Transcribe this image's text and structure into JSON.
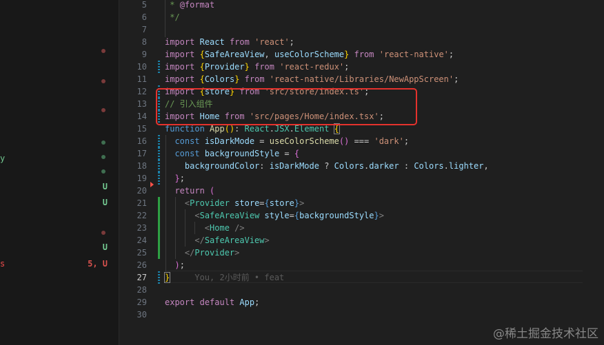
{
  "sidebar": {
    "fragments": [
      {
        "text": "y",
        "color": "#73c991"
      },
      {
        "text": "s",
        "color": "#f14c4c"
      }
    ],
    "status_letters": [
      "U",
      "U",
      "U",
      "U",
      "5, U"
    ]
  },
  "gutter": {
    "line_numbers": [
      "5",
      "6",
      "7",
      "8",
      "9",
      "10",
      "11",
      "12",
      "13",
      "14",
      "15",
      "16",
      "17",
      "18",
      "19",
      "20",
      "21",
      "22",
      "23",
      "24",
      "25",
      "26",
      "27",
      "28",
      "29",
      "30"
    ],
    "active_line": "27"
  },
  "code": {
    "l5": {
      "t1": " * ",
      "t2": "@format"
    },
    "l6": {
      "t1": " */"
    },
    "l8": {
      "k": "import",
      "a": "React",
      "f": "from",
      "s": "'react'",
      "e": ";"
    },
    "l9": {
      "k": "import",
      "o": "{",
      "a": "SafeAreaView",
      "c": ", ",
      "b": "useColorScheme",
      "x": "}",
      "f": "from",
      "s": "'react-native'",
      "e": ";"
    },
    "l10": {
      "k": "import",
      "o": "{",
      "a": "Provider",
      "x": "}",
      "f": "from",
      "s": "'react-redux'",
      "e": ";"
    },
    "l11": {
      "k": "import",
      "o": "{",
      "a": "Colors",
      "x": "}",
      "f": "from",
      "s": "'react-native/Libraries/NewAppScreen'",
      "e": ";"
    },
    "l12": {
      "k": "import",
      "o": "{",
      "a": "store",
      "x": "}",
      "f": "from",
      "s": "'src/store/index.ts'",
      "e": ";"
    },
    "l13": {
      "cm": "// 引入组件"
    },
    "l14": {
      "k": "import",
      "a": "Home",
      "f": "from",
      "s": "'src/pages/Home/index.tsx'",
      "e": ";"
    },
    "l15": {
      "k": "function",
      "n": "App",
      "p": "()",
      "c": ": ",
      "ns": "React",
      "d": ".",
      "ty": "JSX",
      "d2": ".",
      "ty2": "Element",
      "br": "{"
    },
    "l16": {
      "k": "const",
      "v": "isDarkMode",
      "eq": " = ",
      "fn": "useColorScheme",
      "p": "()",
      "op": " === ",
      "s": "'dark'",
      "e": ";"
    },
    "l17": {
      "k": "const",
      "v": "backgroundStyle",
      "eq": " = ",
      "br": "{"
    },
    "l18": {
      "p": "backgroundColor",
      "c": ": ",
      "v": "isDarkMode",
      "q": " ? ",
      "o1": "Colors",
      "d": ".",
      "o2": "darker",
      "col": " : ",
      "o3": "Colors",
      "d2": ".",
      "o4": "lighter",
      "cm": ","
    },
    "l19": {
      "br": "}",
      "e": ";"
    },
    "l20": {
      "k": "return",
      "br": "("
    },
    "l21": {
      "lt": "<",
      "tag": "Provider",
      "attr": "store",
      "eq": "=",
      "ob": "{",
      "v": "store",
      "cb": "}",
      "gt": ">"
    },
    "l22": {
      "lt": "<",
      "tag": "SafeAreaView",
      "attr": "style",
      "eq": "=",
      "ob": "{",
      "v": "backgroundStyle",
      "cb": "}",
      "gt": ">"
    },
    "l23": {
      "lt": "<",
      "tag": "Home",
      "gt": " />"
    },
    "l24": {
      "lt": "</",
      "tag": "SafeAreaView",
      "gt": ">"
    },
    "l25": {
      "lt": "</",
      "tag": "Provider",
      "gt": ">"
    },
    "l26": {
      "br": ")",
      "e": ";"
    },
    "l27": {
      "br": "}",
      "blame": "You, 2小时前 • feat"
    },
    "l29": {
      "k": "export",
      "k2": "default",
      "v": "App",
      "e": ";"
    }
  },
  "watermark": "@稀土掘金技术社区",
  "colors": {
    "highlight": "#e5322d",
    "editor_bg": "#1f1f1f",
    "sidebar_bg": "#181818"
  }
}
